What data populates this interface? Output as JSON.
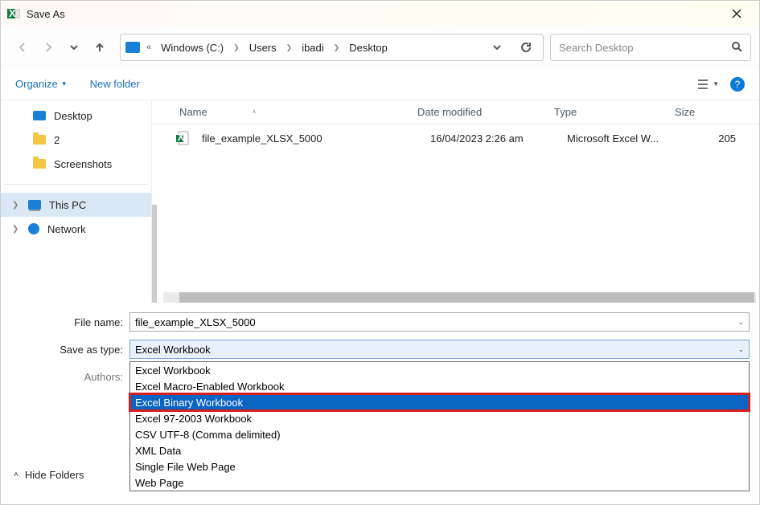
{
  "window": {
    "title": "Save As"
  },
  "breadcrumbs": {
    "b0": "Windows (C:)",
    "b1": "Users",
    "b2": "ibadi",
    "b3": "Desktop"
  },
  "search": {
    "placeholder": "Search Desktop"
  },
  "toolbar": {
    "organize": "Organize",
    "newfolder": "New folder",
    "help": "?"
  },
  "sidebar": {
    "desktop": "Desktop",
    "two": "2",
    "screenshots": "Screenshots",
    "thispc": "This PC",
    "network": "Network"
  },
  "columns": {
    "name": "Name",
    "date": "Date modified",
    "type": "Type",
    "size": "Size"
  },
  "files": {
    "0": {
      "name": "file_example_XLSX_5000",
      "date": "16/04/2023 2:26 am",
      "type": "Microsoft Excel W...",
      "size": "205"
    }
  },
  "form": {
    "filename_label": "File name:",
    "filename_value": "file_example_XLSX_5000",
    "type_label": "Save as type:",
    "type_value": "Excel Workbook",
    "authors_label": "Authors:"
  },
  "dropdown": {
    "0": "Excel Workbook",
    "1": "Excel Macro-Enabled Workbook",
    "2": "Excel Binary Workbook",
    "3": "Excel 97-2003 Workbook",
    "4": "CSV UTF-8 (Comma delimited)",
    "5": "XML Data",
    "6": "Single File Web Page",
    "7": "Web Page"
  },
  "footer": {
    "hide": "Hide Folders"
  }
}
